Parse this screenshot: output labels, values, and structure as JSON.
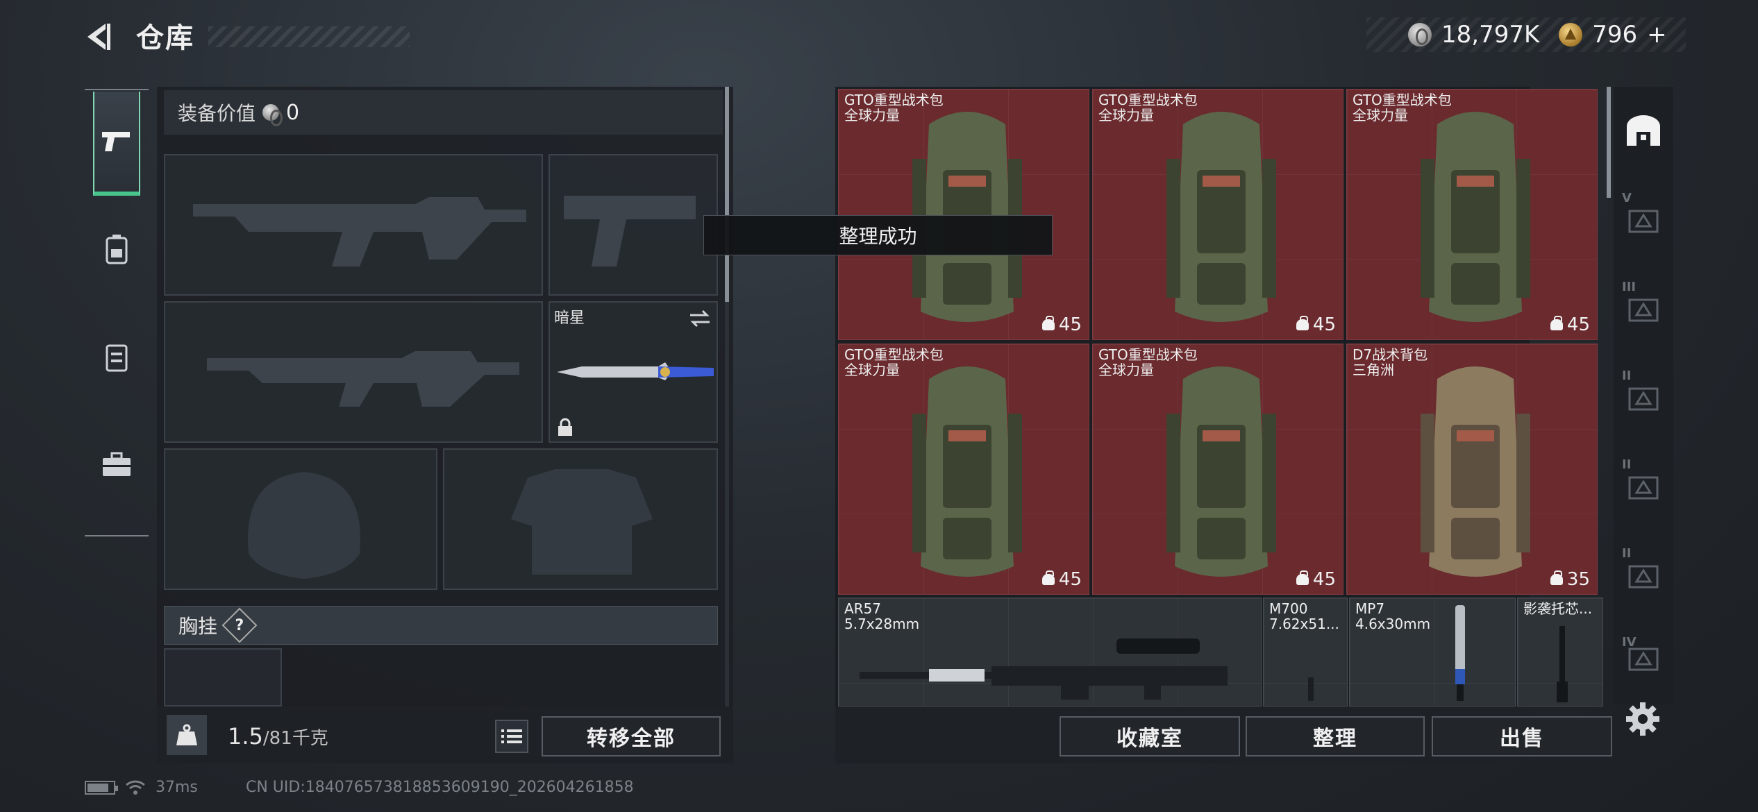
{
  "header": {
    "title": "仓库"
  },
  "currency": {
    "silver": "18,797K",
    "gold": "796",
    "add": "+"
  },
  "equipment": {
    "value_label": "装备价值",
    "value": "0",
    "knife_name": "暗星",
    "section_chest_rig": "胸挂",
    "section_help": "?"
  },
  "weight": {
    "current": "1.5",
    "max": "/81千克"
  },
  "buttons": {
    "transfer_all": "转移全部",
    "collection": "收藏室",
    "organize": "整理",
    "sell": "出售"
  },
  "toast": "整理成功",
  "inventory": [
    {
      "name": "GTO重型战术包",
      "sub": "全球力量",
      "count": "45"
    },
    {
      "name": "GTO重型战术包",
      "sub": "全球力量",
      "count": "45"
    },
    {
      "name": "GTO重型战术包",
      "sub": "全球力量",
      "count": "45"
    },
    {
      "name": "GTO重型战术包",
      "sub": "全球力量",
      "count": "45"
    },
    {
      "name": "GTO重型战术包",
      "sub": "全球力量",
      "count": "45"
    },
    {
      "name": "D7战术背包",
      "sub": "三角洲",
      "count": "35"
    }
  ],
  "weapons_row": [
    {
      "name": "AR57",
      "sub": "5.7x28mm"
    },
    {
      "name": "M700",
      "sub": "7.62x51..."
    },
    {
      "name": "MP7",
      "sub": "4.6x30mm"
    },
    {
      "name": "影袭托芯...",
      "sub": ""
    }
  ],
  "categories": [
    "",
    "V",
    "III",
    "II",
    "II",
    "II",
    "IV"
  ],
  "status": {
    "ping": "37ms",
    "uid": "CN UID:1840765738188536091​90_202604261858"
  },
  "colors": {
    "accent": "#48c58c",
    "item_bg": "#6a2a2e"
  },
  "icons": [
    "back-arrow-icon",
    "pistol-icon",
    "backpack-icon",
    "chest-rig-icon",
    "briefcase-icon",
    "weight-icon",
    "list-icon",
    "gear-icon",
    "wifi-icon",
    "battery-icon"
  ]
}
